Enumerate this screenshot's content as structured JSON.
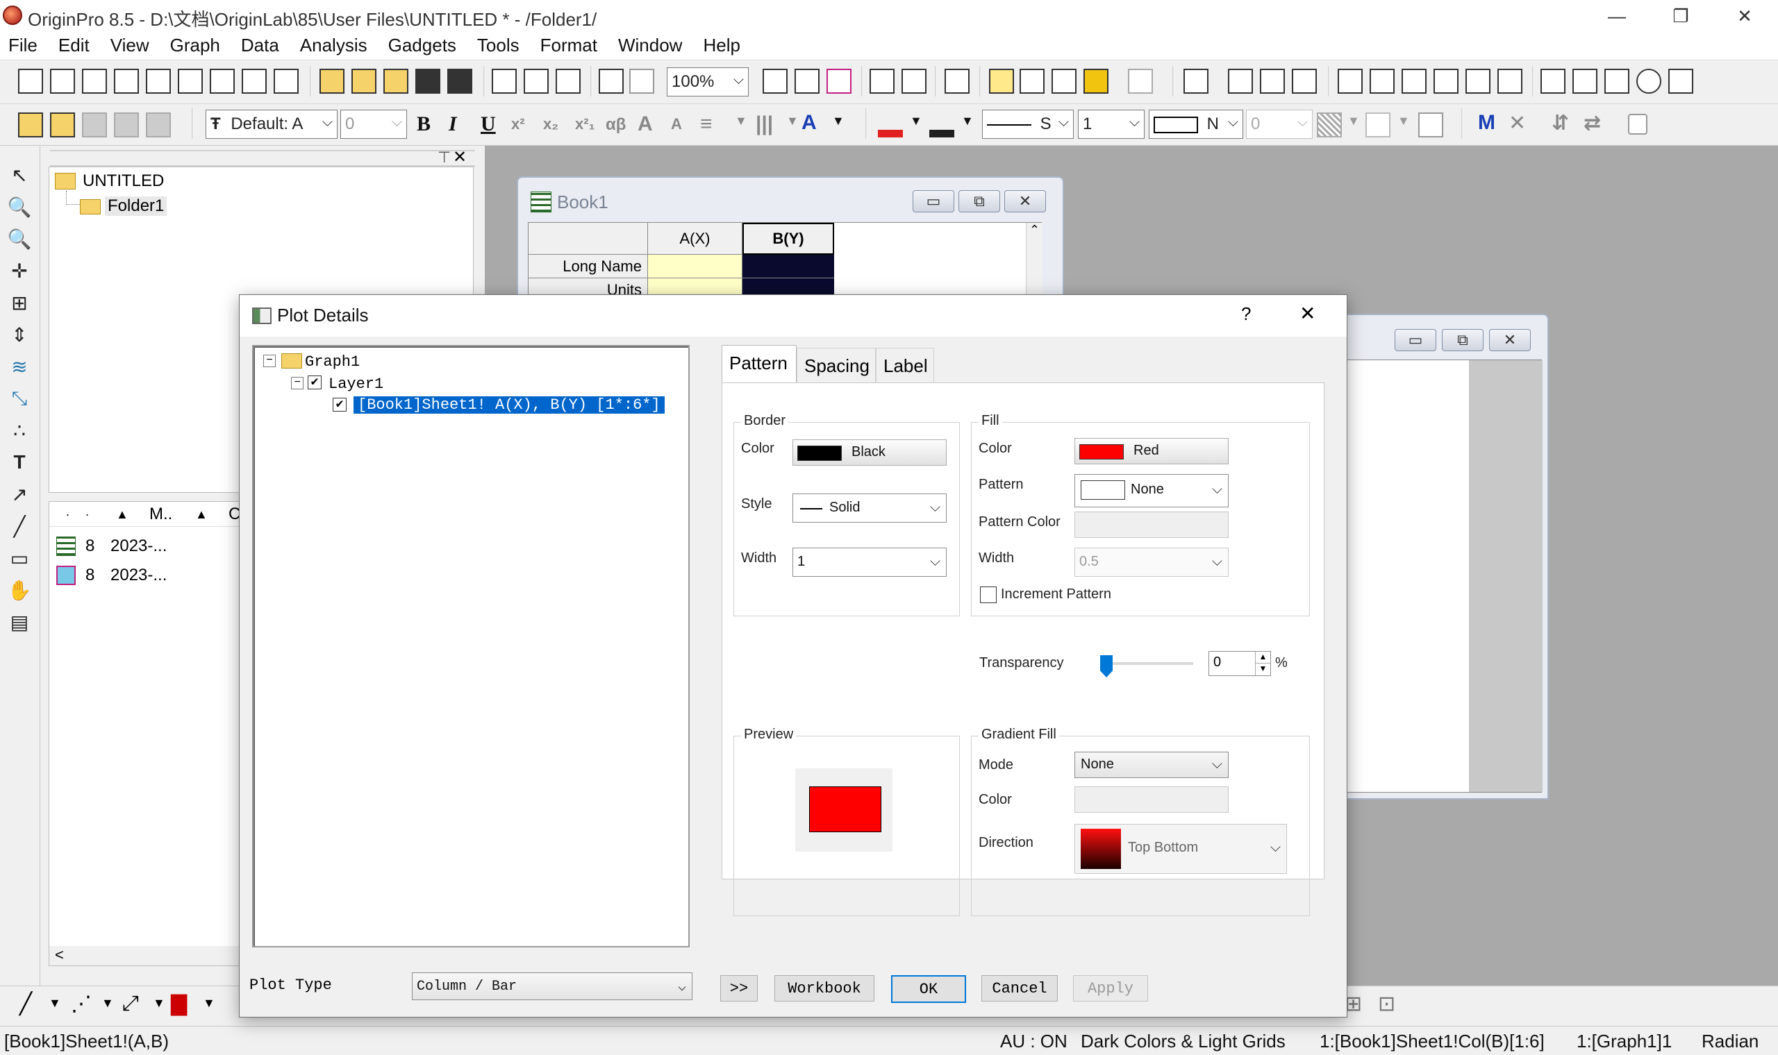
{
  "app": {
    "title": "OriginPro 8.5 - D:\\文档\\OriginLab\\85\\User Files\\UNTITLED * - /Folder1/",
    "window_controls": {
      "minimize": "—",
      "restore": "❐",
      "close": "✕"
    }
  },
  "menu": [
    "File",
    "Edit",
    "View",
    "Graph",
    "Data",
    "Analysis",
    "Gadgets",
    "Tools",
    "Format",
    "Window",
    "Help"
  ],
  "toolbar": {
    "zoom_value": "100%",
    "font_name": "Default: A",
    "font_size": "0",
    "bold": "B",
    "italic": "I",
    "underline": "U",
    "line_style_value": "S",
    "line_width_value": "1",
    "fill_none": "N",
    "fill_value": "0",
    "colors": {
      "fill_icon": "#e02020",
      "line_icon": "#202020",
      "font_icon": "#1a3fb5"
    }
  },
  "explorer": {
    "root": "UNTITLED",
    "folder": "Folder1",
    "list_headers": [
      "M..",
      "C"
    ],
    "items": [
      {
        "icon": "workbook-icon",
        "number": "8",
        "date": "2023-..."
      },
      {
        "icon": "graph-icon",
        "number": "8",
        "date": "2023-..."
      }
    ]
  },
  "book1": {
    "title": "Book1",
    "columns": [
      "A(X)",
      "B(Y)"
    ],
    "row_labels": [
      "Long Name",
      "Units"
    ]
  },
  "dialog": {
    "title": "Plot Details",
    "help": "?",
    "close": "✕",
    "tree": {
      "graph": "Graph1",
      "layer": "Layer1",
      "plot": "[Book1]Sheet1! A(X), B(Y) [1*:6*]"
    },
    "tabs": [
      "Pattern",
      "Spacing",
      "Label"
    ],
    "active_tab": "Pattern",
    "border": {
      "title": "Border",
      "color_label": "Color",
      "color_value": "Black",
      "color_hex": "#000000",
      "style_label": "Style",
      "style_value": "Solid",
      "width_label": "Width",
      "width_value": "1"
    },
    "fill": {
      "title": "Fill",
      "color_label": "Color",
      "color_value": "Red",
      "color_hex": "#ff0000",
      "pattern_label": "Pattern",
      "pattern_value": "None",
      "pattern_color_label": "Pattern Color",
      "width_label": "Width",
      "width_value": "0.5",
      "increment_label": "Increment Pattern"
    },
    "transparency": {
      "label": "Transparency",
      "value": "0",
      "unit": "%",
      "level": 0
    },
    "preview": {
      "title": "Preview",
      "fill_hex": "#ff0000"
    },
    "gradient": {
      "title": "Gradient Fill",
      "mode_label": "Mode",
      "mode_value": "None",
      "color_label": "Color",
      "direction_label": "Direction",
      "direction_value": "Top Bottom"
    },
    "plot_type_label": "Plot Type",
    "plot_type_value": "Column / Bar",
    "buttons": {
      "expand": ">>",
      "workbook": "Workbook",
      "ok": "OK",
      "cancel": "Cancel",
      "apply": "Apply"
    }
  },
  "graph_window": {
    "bar_color": "#ff0000"
  },
  "status": {
    "left": "[Book1]Sheet1!(A,B)",
    "au": "AU : ON",
    "theme": "Dark Colors & Light Grids",
    "cell": "1:[Book1]Sheet1!Col(B)[1:6]",
    "layer": "1:[Graph1]1",
    "angle": "Radian"
  }
}
